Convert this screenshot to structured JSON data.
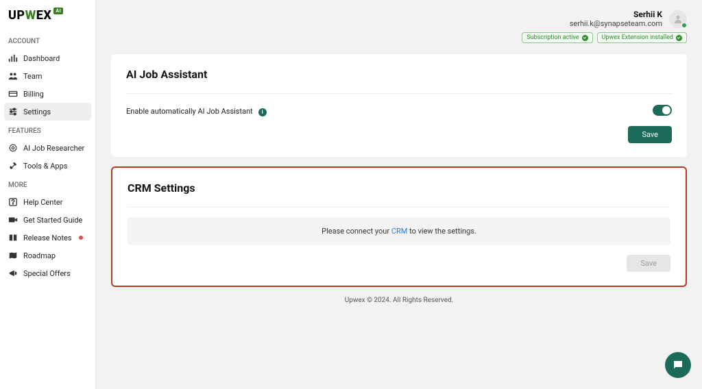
{
  "brand": {
    "name": "UPWEX",
    "badge": "AI"
  },
  "sidebar": {
    "section_account": "ACCOUNT",
    "account_items": [
      {
        "label": "Dashboard"
      },
      {
        "label": "Team"
      },
      {
        "label": "Billing"
      },
      {
        "label": "Settings"
      }
    ],
    "section_features": "FEATURES",
    "features_items": [
      {
        "label": "AI Job Researcher"
      },
      {
        "label": "Tools & Apps"
      }
    ],
    "section_more": "MORE",
    "more_items": [
      {
        "label": "Help Center"
      },
      {
        "label": "Get Started Guide"
      },
      {
        "label": "Release Notes",
        "dot": true
      },
      {
        "label": "Roadmap"
      },
      {
        "label": "Special Offers"
      }
    ]
  },
  "user": {
    "name": "Serhii K",
    "email": "serhii.k@synapseteam.com",
    "badge_subscription": "Subscription active",
    "badge_extension": "Upwex Extension installed"
  },
  "card_ai": {
    "title": "AI Job Assistant",
    "label": "Enable automatically AI Job Assistant",
    "save": "Save"
  },
  "card_crm": {
    "title": "CRM Settings",
    "connect_prefix": "Please connect your ",
    "connect_link": "CRM",
    "connect_suffix": " to view the settings.",
    "save": "Save"
  },
  "footer": "Upwex © 2024. All Rights Reserved."
}
